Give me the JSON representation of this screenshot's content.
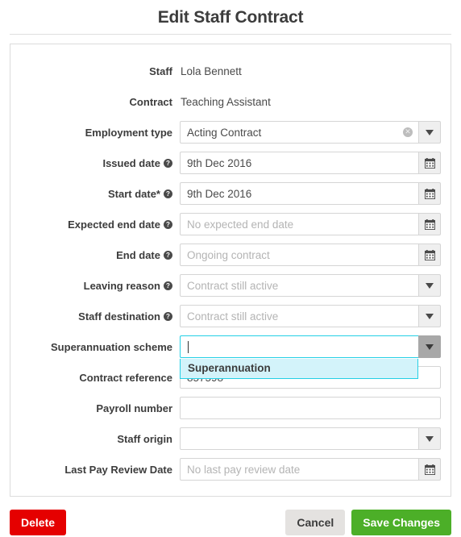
{
  "header": {
    "title": "Edit Staff Contract"
  },
  "form": {
    "rows": [
      {
        "label": "Staff",
        "type": "static",
        "value": "Lola Bennett"
      },
      {
        "label": "Contract",
        "type": "static",
        "value": "Teaching Assistant"
      },
      {
        "label": "Employment type",
        "type": "select-clearable",
        "value": "Acting Contract",
        "clear_icon": "clear-circle-icon",
        "caret_icon": "chevron-down-icon"
      },
      {
        "label": "Issued date",
        "help": "?",
        "type": "date",
        "value": "9th Dec 2016",
        "icon": "calendar-icon"
      },
      {
        "label": "Start date*",
        "help": "?",
        "type": "date",
        "value": "9th Dec 2016",
        "icon": "calendar-icon"
      },
      {
        "label": "Expected end date",
        "help": "?",
        "type": "date",
        "value": "",
        "placeholder": "No expected end date",
        "icon": "calendar-icon"
      },
      {
        "label": "End date",
        "help": "?",
        "type": "date",
        "value": "",
        "placeholder": "Ongoing contract",
        "icon": "calendar-icon"
      },
      {
        "label": "Leaving reason",
        "help": "?",
        "type": "select",
        "value": "",
        "placeholder": "Contract still active",
        "caret_icon": "chevron-down-icon"
      },
      {
        "label": "Staff destination",
        "help": "?",
        "type": "select",
        "value": "",
        "placeholder": "Contract still active",
        "caret_icon": "chevron-down-icon"
      },
      {
        "label": "Superannuation scheme",
        "type": "combobox-focused",
        "value": "",
        "caret_icon": "chevron-down-icon"
      },
      {
        "label": "Contract reference",
        "type": "text",
        "value": "857598"
      },
      {
        "label": "Payroll number",
        "type": "text",
        "value": ""
      },
      {
        "label": "Staff origin",
        "type": "select",
        "value": "",
        "caret_icon": "chevron-down-icon"
      },
      {
        "label": "Last Pay Review Date",
        "type": "date",
        "value": "",
        "placeholder": "No last pay review date",
        "icon": "calendar-icon"
      }
    ],
    "suggestions": {
      "visible": true,
      "items": [
        "Superannuation"
      ]
    }
  },
  "footer": {
    "delete_label": "Delete",
    "cancel_label": "Cancel",
    "save_label": "Save Changes"
  },
  "colors": {
    "delete": "#e50000",
    "save": "#4caf28",
    "cancel": "#e4e2e0",
    "focus": "#24d0e6",
    "suggestion_bg": "#d3f3fa"
  }
}
